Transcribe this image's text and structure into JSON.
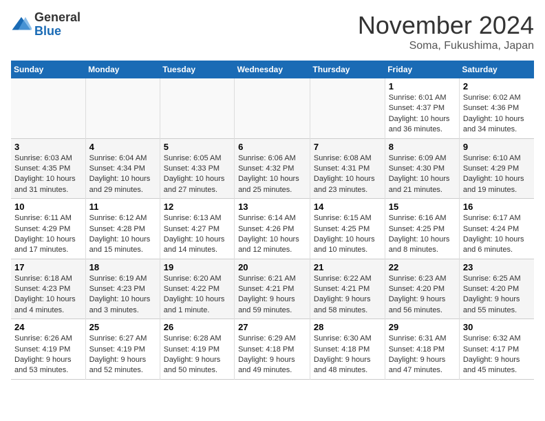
{
  "header": {
    "logo_general": "General",
    "logo_blue": "Blue",
    "month_title": "November 2024",
    "location": "Soma, Fukushima, Japan"
  },
  "days_of_week": [
    "Sunday",
    "Monday",
    "Tuesday",
    "Wednesday",
    "Thursday",
    "Friday",
    "Saturday"
  ],
  "weeks": [
    {
      "days": [
        {
          "num": "",
          "info": "",
          "empty": true
        },
        {
          "num": "",
          "info": "",
          "empty": true
        },
        {
          "num": "",
          "info": "",
          "empty": true
        },
        {
          "num": "",
          "info": "",
          "empty": true
        },
        {
          "num": "",
          "info": "",
          "empty": true
        },
        {
          "num": "1",
          "info": "Sunrise: 6:01 AM\nSunset: 4:37 PM\nDaylight: 10 hours and 36 minutes."
        },
        {
          "num": "2",
          "info": "Sunrise: 6:02 AM\nSunset: 4:36 PM\nDaylight: 10 hours and 34 minutes."
        }
      ]
    },
    {
      "days": [
        {
          "num": "3",
          "info": "Sunrise: 6:03 AM\nSunset: 4:35 PM\nDaylight: 10 hours and 31 minutes."
        },
        {
          "num": "4",
          "info": "Sunrise: 6:04 AM\nSunset: 4:34 PM\nDaylight: 10 hours and 29 minutes."
        },
        {
          "num": "5",
          "info": "Sunrise: 6:05 AM\nSunset: 4:33 PM\nDaylight: 10 hours and 27 minutes."
        },
        {
          "num": "6",
          "info": "Sunrise: 6:06 AM\nSunset: 4:32 PM\nDaylight: 10 hours and 25 minutes."
        },
        {
          "num": "7",
          "info": "Sunrise: 6:08 AM\nSunset: 4:31 PM\nDaylight: 10 hours and 23 minutes."
        },
        {
          "num": "8",
          "info": "Sunrise: 6:09 AM\nSunset: 4:30 PM\nDaylight: 10 hours and 21 minutes."
        },
        {
          "num": "9",
          "info": "Sunrise: 6:10 AM\nSunset: 4:29 PM\nDaylight: 10 hours and 19 minutes."
        }
      ]
    },
    {
      "days": [
        {
          "num": "10",
          "info": "Sunrise: 6:11 AM\nSunset: 4:29 PM\nDaylight: 10 hours and 17 minutes."
        },
        {
          "num": "11",
          "info": "Sunrise: 6:12 AM\nSunset: 4:28 PM\nDaylight: 10 hours and 15 minutes."
        },
        {
          "num": "12",
          "info": "Sunrise: 6:13 AM\nSunset: 4:27 PM\nDaylight: 10 hours and 14 minutes."
        },
        {
          "num": "13",
          "info": "Sunrise: 6:14 AM\nSunset: 4:26 PM\nDaylight: 10 hours and 12 minutes."
        },
        {
          "num": "14",
          "info": "Sunrise: 6:15 AM\nSunset: 4:25 PM\nDaylight: 10 hours and 10 minutes."
        },
        {
          "num": "15",
          "info": "Sunrise: 6:16 AM\nSunset: 4:25 PM\nDaylight: 10 hours and 8 minutes."
        },
        {
          "num": "16",
          "info": "Sunrise: 6:17 AM\nSunset: 4:24 PM\nDaylight: 10 hours and 6 minutes."
        }
      ]
    },
    {
      "days": [
        {
          "num": "17",
          "info": "Sunrise: 6:18 AM\nSunset: 4:23 PM\nDaylight: 10 hours and 4 minutes."
        },
        {
          "num": "18",
          "info": "Sunrise: 6:19 AM\nSunset: 4:23 PM\nDaylight: 10 hours and 3 minutes."
        },
        {
          "num": "19",
          "info": "Sunrise: 6:20 AM\nSunset: 4:22 PM\nDaylight: 10 hours and 1 minute."
        },
        {
          "num": "20",
          "info": "Sunrise: 6:21 AM\nSunset: 4:21 PM\nDaylight: 9 hours and 59 minutes."
        },
        {
          "num": "21",
          "info": "Sunrise: 6:22 AM\nSunset: 4:21 PM\nDaylight: 9 hours and 58 minutes."
        },
        {
          "num": "22",
          "info": "Sunrise: 6:23 AM\nSunset: 4:20 PM\nDaylight: 9 hours and 56 minutes."
        },
        {
          "num": "23",
          "info": "Sunrise: 6:25 AM\nSunset: 4:20 PM\nDaylight: 9 hours and 55 minutes."
        }
      ]
    },
    {
      "days": [
        {
          "num": "24",
          "info": "Sunrise: 6:26 AM\nSunset: 4:19 PM\nDaylight: 9 hours and 53 minutes."
        },
        {
          "num": "25",
          "info": "Sunrise: 6:27 AM\nSunset: 4:19 PM\nDaylight: 9 hours and 52 minutes."
        },
        {
          "num": "26",
          "info": "Sunrise: 6:28 AM\nSunset: 4:19 PM\nDaylight: 9 hours and 50 minutes."
        },
        {
          "num": "27",
          "info": "Sunrise: 6:29 AM\nSunset: 4:18 PM\nDaylight: 9 hours and 49 minutes."
        },
        {
          "num": "28",
          "info": "Sunrise: 6:30 AM\nSunset: 4:18 PM\nDaylight: 9 hours and 48 minutes."
        },
        {
          "num": "29",
          "info": "Sunrise: 6:31 AM\nSunset: 4:18 PM\nDaylight: 9 hours and 47 minutes."
        },
        {
          "num": "30",
          "info": "Sunrise: 6:32 AM\nSunset: 4:17 PM\nDaylight: 9 hours and 45 minutes."
        }
      ]
    }
  ]
}
